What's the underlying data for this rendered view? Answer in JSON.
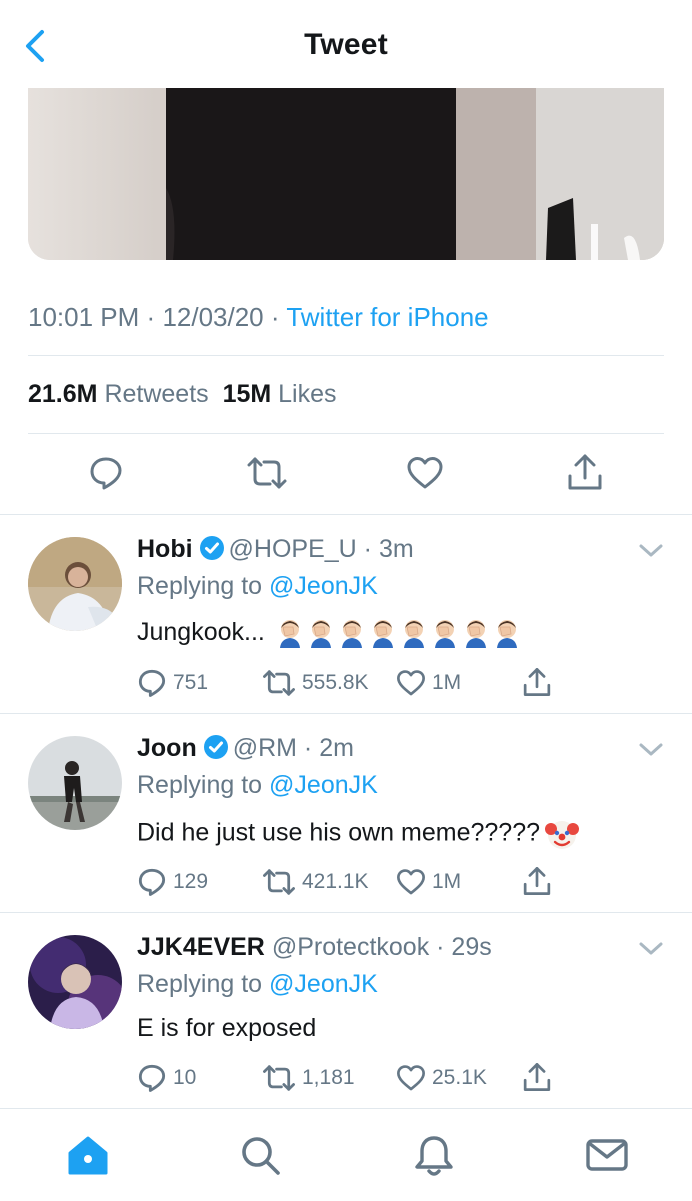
{
  "header": {
    "title": "Tweet"
  },
  "tweet": {
    "time": "10:01 PM",
    "separator": "·",
    "date": "12/03/20",
    "client": "Twitter for iPhone",
    "retweets_count": "21.6M",
    "retweets_label": "Retweets",
    "likes_count": "15M",
    "likes_label": "Likes"
  },
  "replies": [
    {
      "name": "Hobi",
      "handle": "@HOPE_U",
      "time": "3m",
      "replying_label": "Replying to",
      "replying_to": "@JeonJK",
      "text": "Jungkook...",
      "emoji": "facepalm-emoji",
      "emoji_count": 8,
      "reply_count": "751",
      "retweet_count": "555.8K",
      "like_count": "1M"
    },
    {
      "name": "Joon",
      "handle": "@RM",
      "time": "2m",
      "replying_label": "Replying to",
      "replying_to": "@JeonJK",
      "text": "Did he just use his own meme?????",
      "emoji": "clown-emoji",
      "reply_count": "129",
      "retweet_count": "421.1K",
      "like_count": "1M"
    },
    {
      "name": "JJK4EVER",
      "handle": "@Protectkook",
      "time": "29s",
      "replying_label": "Replying to",
      "replying_to": "@JeonJK",
      "text": "E is for exposed",
      "reply_count": "10",
      "retweet_count": "1,181",
      "like_count": "25.1K"
    }
  ],
  "colors": {
    "accent": "#1da1f2",
    "text": "#14171a",
    "secondary": "#657786",
    "divider": "#e1e8ed"
  },
  "tabbar": [
    "home-icon",
    "search-icon",
    "notifications-icon",
    "messages-icon"
  ]
}
